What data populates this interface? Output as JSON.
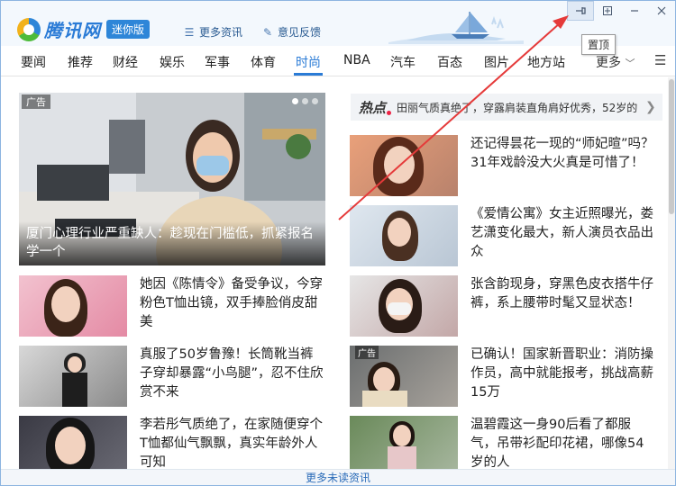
{
  "app": {
    "brand": "腾讯网",
    "badge": "迷你版",
    "links": [
      "更多资讯",
      "意见反馈"
    ]
  },
  "window_controls": {
    "pin_tooltip": "置顶"
  },
  "nav": {
    "items": [
      "要闻",
      "推荐",
      "财经",
      "娱乐",
      "军事",
      "体育",
      "时尚",
      "NBA",
      "汽车",
      "百态",
      "图片",
      "地方站"
    ],
    "active": "时尚",
    "more_label": "更多"
  },
  "hero": {
    "ad_tag": "广告",
    "caption": "厦门心理行业严重缺人：趁现在门槛低，抓紧报名学一个",
    "slide_count": 3,
    "active_slide": 1
  },
  "hot": {
    "label": "热点",
    "text": "田丽气质真绝了，穿露肩装直角肩好优秀，52岁的"
  },
  "left_cards": [
    {
      "title": "她因《陈情令》备受争议，今穿粉色T恤出镜，双手捧脸俏皮甜美"
    },
    {
      "title": "真服了50岁鲁豫！长筒靴当裤子穿却暴露“小鸟腿”，忍不住欣赏不来"
    },
    {
      "title": "李若彤气质绝了，在家随便穿个T恤都仙气飘飘，真实年龄外人可知"
    }
  ],
  "right_cards": [
    {
      "title": "还记得昙花一现的“师妃暄”吗？31年戏龄没大火真是可惜了！",
      "ad": ""
    },
    {
      "title": "《爱情公寓》女主近照曝光，娄艺潇变化最大，新人演员衣品出众",
      "ad": ""
    },
    {
      "title": "张含韵现身，穿黑色皮衣搭牛仔裤，系上腰带时髦又显状态！",
      "ad": ""
    },
    {
      "title": "已确认！国家新晋职业：消防操作员，高中就能报考，挑战高薪15万",
      "ad": "广告"
    },
    {
      "title": "温碧霞这一身90后看了都服气，吊带衫配印花裙，哪像54岁的人",
      "ad": ""
    }
  ],
  "footer": {
    "label": "更多未读资讯"
  },
  "colors": {
    "accent": "#2a7bd6",
    "annotation_arrow": "#e53a3a"
  }
}
